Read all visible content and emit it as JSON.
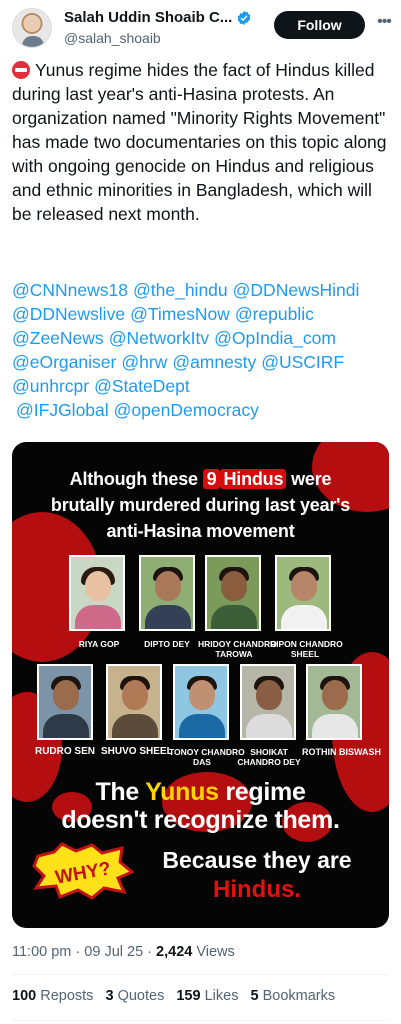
{
  "author": {
    "display_name": "Salah Uddin Shoaib C...",
    "handle": "@salah_shoaib",
    "verified": true
  },
  "follow_label": "Follow",
  "more_icon": "more-horizontal-icon",
  "tweet": {
    "stop_icon": "stop-sign-emoji",
    "text": "Yunus regime hides the fact of Hindus killed during last year's anti-Hasina protests. An organization named \"Minority Rights Movement\" has made two documentaries on this topic along with ongoing genocide on Hindus and religious and ethnic minorities in Bangladesh, which will be released next month.",
    "mentions": [
      "@CNNnews18",
      "@the_hindu",
      "@DDNewsHindi",
      "@DDNewslive",
      "@TimesNow",
      "@republic",
      "@ZeeNews",
      "@NetworkItv",
      "@OpIndia_com",
      "@eOrganiser",
      "@hrw",
      "@amnesty",
      "@USCIRF",
      "@unhrcpr",
      "@StateDept",
      "@IFJGlobal",
      "@openDemocracy"
    ]
  },
  "media": {
    "headline_pre": "Although these",
    "headline_num": "9",
    "headline_word": "Hindus",
    "headline_post": "were",
    "headline_line2": "brutally murdered during last year's",
    "headline_line3": "anti-Hasina movement",
    "victims": [
      {
        "name": "RIYA GOP",
        "name2": ""
      },
      {
        "name": "DIPTO DEY",
        "name2": ""
      },
      {
        "name": "HRIDOY CHANDRO",
        "name2": "TAROWA"
      },
      {
        "name": "RIPON CHANDRO",
        "name2": "SHEEL"
      },
      {
        "name": "RUDRO SEN",
        "name2": ""
      },
      {
        "name": "SHUVO SHEEL",
        "name2": ""
      },
      {
        "name": "TONOY CHANDRO",
        "name2": "DAS"
      },
      {
        "name": "SHOIKAT",
        "name2": "CHANDRO DEY"
      },
      {
        "name": "ROTHIN BISWASH",
        "name2": ""
      }
    ],
    "line_the": "The",
    "line_yunus": "Yunus",
    "line_regime": "regime",
    "line_doesnt": "doesn't recognize them.",
    "why_badge": "WHY?",
    "because": "Because they are",
    "hindus": "Hindus."
  },
  "meta": {
    "time": "11:00 pm",
    "date": "09 Jul 25",
    "views_count": "2,424",
    "views_label": "Views"
  },
  "stats": {
    "reposts_count": "100",
    "reposts_label": "Reposts",
    "quotes_count": "3",
    "quotes_label": "Quotes",
    "likes_count": "159",
    "likes_label": "Likes",
    "bookmarks_count": "5",
    "bookmarks_label": "Bookmarks"
  },
  "colors": {
    "link": "#1d9bf0",
    "follow_bg": "#0f1419",
    "verified": "#1d9bf0",
    "blood_red": "#b40e10",
    "highlight_yellow": "#ffd400"
  }
}
